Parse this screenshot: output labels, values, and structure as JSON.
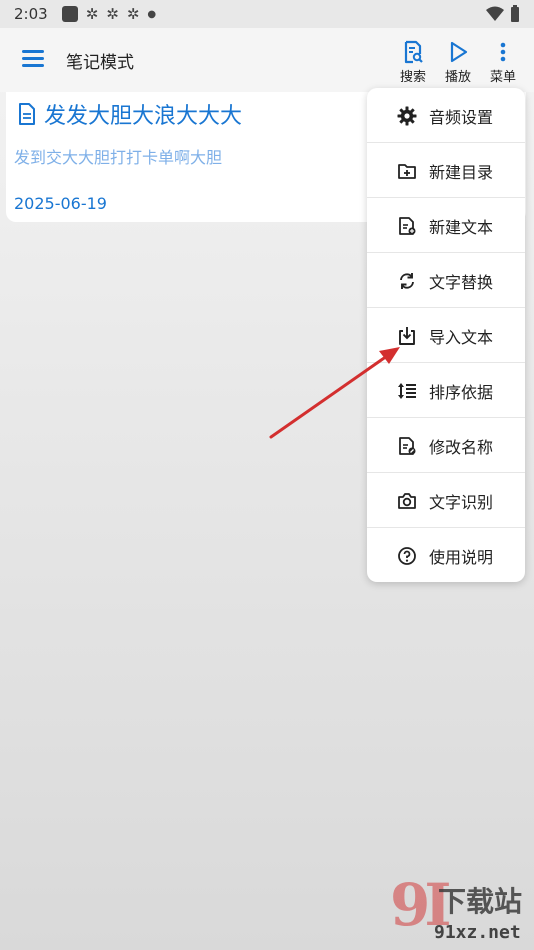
{
  "status_bar": {
    "time": "2:03"
  },
  "app_bar": {
    "title": "笔记模式",
    "actions": [
      {
        "label": "搜索",
        "icon": "search-doc-icon"
      },
      {
        "label": "播放",
        "icon": "play-icon"
      },
      {
        "label": "菜单",
        "icon": "more-vert-icon"
      }
    ]
  },
  "note": {
    "title": "发发大胆大浪大大大",
    "body": "发到交大大胆打打卡单啊大胆",
    "date": "2025-06-19"
  },
  "menu": {
    "items": [
      {
        "label": "音频设置",
        "icon": "gear-icon"
      },
      {
        "label": "新建目录",
        "icon": "new-folder-icon"
      },
      {
        "label": "新建文本",
        "icon": "new-text-icon"
      },
      {
        "label": "文字替换",
        "icon": "replace-icon"
      },
      {
        "label": "导入文本",
        "icon": "import-icon"
      },
      {
        "label": "排序依据",
        "icon": "sort-icon"
      },
      {
        "label": "修改名称",
        "icon": "rename-icon"
      },
      {
        "label": "文字识别",
        "icon": "camera-icon"
      },
      {
        "label": "使用说明",
        "icon": "help-icon"
      }
    ]
  },
  "watermark": {
    "brand": "下载站",
    "url": "91xz.net"
  },
  "colors": {
    "accent": "#1976d2",
    "arrow": "#d32f2f"
  }
}
